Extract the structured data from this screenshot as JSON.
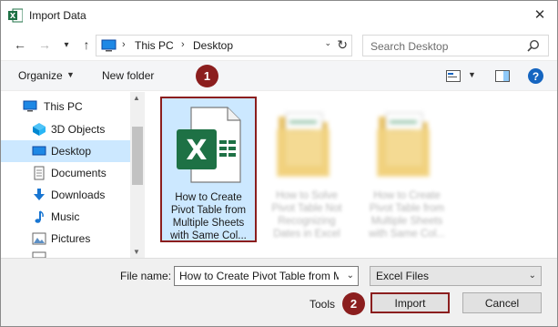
{
  "title": "Import Data",
  "nav": {
    "back": "←",
    "forward": "→",
    "recent": "⌄",
    "up": "↑",
    "path": [
      "This PC",
      "Desktop"
    ],
    "search_placeholder": "Search Desktop"
  },
  "toolbar": {
    "organize": "Organize",
    "new_folder": "New folder",
    "help": "?"
  },
  "badges": {
    "one": "1",
    "two": "2"
  },
  "sidebar": {
    "items": [
      {
        "label": "This PC",
        "icon": "pc-icon"
      },
      {
        "label": "3D Objects",
        "icon": "3d-objects-icon"
      },
      {
        "label": "Desktop",
        "icon": "desktop-icon",
        "selected": true
      },
      {
        "label": "Documents",
        "icon": "documents-icon"
      },
      {
        "label": "Downloads",
        "icon": "downloads-icon"
      },
      {
        "label": "Music",
        "icon": "music-icon"
      },
      {
        "label": "Pictures",
        "icon": "pictures-icon"
      }
    ]
  },
  "files": [
    {
      "name": "How to Create Pivot Table from Multiple Sheets with Same Col...",
      "lines": [
        "How to Create",
        "Pivot Table from",
        "Multiple Sheets",
        "with Same Col..."
      ],
      "type": "excel-file",
      "selected": true
    },
    {
      "name": "How to Solve Pivot Table Not Recognizing Dates in Excel",
      "lines": [
        "How to Solve",
        "Pivot Table Not",
        "Recognizing",
        "Dates in Excel"
      ],
      "type": "folder",
      "blurred": true
    },
    {
      "name": "How to Create Pivot Table from Multiple Sheets with Same Col...",
      "lines": [
        "How to Create",
        "Pivot Table from",
        "Multiple Sheets",
        "with Same Col..."
      ],
      "type": "folder",
      "blurred": true
    }
  ],
  "bottom": {
    "file_name_label": "File name:",
    "file_name_value": "How to Create Pivot Table from M",
    "file_type": "Excel Files",
    "tools": "Tools",
    "import": "Import",
    "cancel": "Cancel"
  },
  "colors": {
    "accent_selected": "#cce8ff",
    "highlight_border": "#8b1e1e",
    "excel_green": "#1e7145"
  }
}
